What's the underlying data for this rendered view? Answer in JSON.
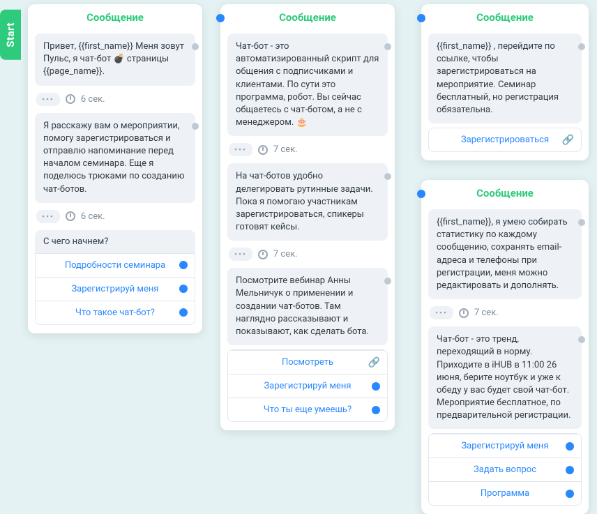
{
  "start_label": "Start",
  "card_title": "Сообщение",
  "delay6": "6 сек.",
  "delay7": "7 сек.",
  "cards": {
    "c1": {
      "msg1": "Привет, {{first_name}}\nМеня зовут Пульс, я чат-бот 💣 страницы {{page_name}}.",
      "msg2": "Я расскажу вам о мероприятии, помогу зарегистрироваться и отправлю напоминание перед началом семинара. Еще я поделюсь трюками по созданию чат-ботов.",
      "question": "С чего начнем?",
      "options": [
        "Подробности семинара",
        "Зарегистрируй меня",
        "Что такое чат-бот?"
      ]
    },
    "c2": {
      "msg1": "Чат-бот - это автоматизированный скрипт для общения с подписчиками и клиентами. По сути это программа, робот.\nВы сейчас общаетесь с чат-ботом, а не с менеджером. 🎂",
      "msg2": "На чат-ботов удобно делегировать рутинные задачи. Пока я помогаю участникам зарегистрироваться, спикеры готовят кейсы.",
      "msg3": "Посмотрите вебинар Анны Мельничук о применении и создании чат-ботов. Там наглядно рассказывают и показывают, как сделать бота.",
      "options": [
        "Посмотреть",
        "Зарегистрируй меня",
        "Что ты еще умеешь?"
      ]
    },
    "c3": {
      "msg1": "{{first_name}} , перейдите по ссылке, чтобы зарегистрироваться на мероприятие. Семинар бесплатный, но регистрация обязательна.",
      "link": "Зарегистрироваться"
    },
    "c4": {
      "msg1": "{{first_name}}, я умею собирать статистику по каждому сообщению, сохранять email-адреса и телефоны при регистрации, меня можно редактировать и дополнять.",
      "msg2": "Чат-бот - это тренд, переходящий в норму. Приходите в iHUB в 11:00 26 июня, берите ноутбук и уже к обеду у вас будет свой чат-бот. Мероприятие бесплатное, по предварительной регистрации.",
      "options": [
        "Зарегистрируй меня",
        "Задать вопрос",
        "Программа"
      ]
    }
  }
}
